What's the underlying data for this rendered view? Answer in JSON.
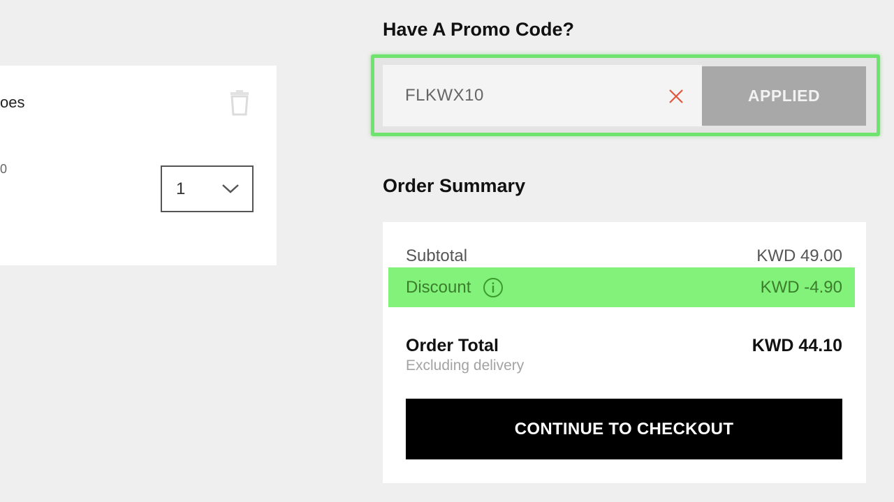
{
  "cart": {
    "item_name_fragment": "oes",
    "item_meta_fragment": "0",
    "quantity": "1"
  },
  "promo": {
    "title": "Have A Promo Code?",
    "code": "FLKWX10",
    "applied_label": "APPLIED"
  },
  "summary": {
    "title": "Order Summary",
    "subtotal_label": "Subtotal",
    "subtotal_value": "KWD 49.00",
    "discount_label": "Discount",
    "discount_value": "KWD -4.90",
    "total_label": "Order Total",
    "total_value": "KWD 44.10",
    "total_note": "Excluding delivery",
    "checkout_label": "CONTINUE TO CHECKOUT"
  },
  "icons": {
    "trash": "trash-icon",
    "chevron": "chevron-down-icon",
    "clear": "close-icon",
    "info": "info-icon"
  },
  "colors": {
    "highlight_green": "#82f27a",
    "promo_border_green": "#6ee36e",
    "clear_x": "#e0573e",
    "discount_text": "#3b7d2c",
    "checkout_bg": "#000000"
  }
}
